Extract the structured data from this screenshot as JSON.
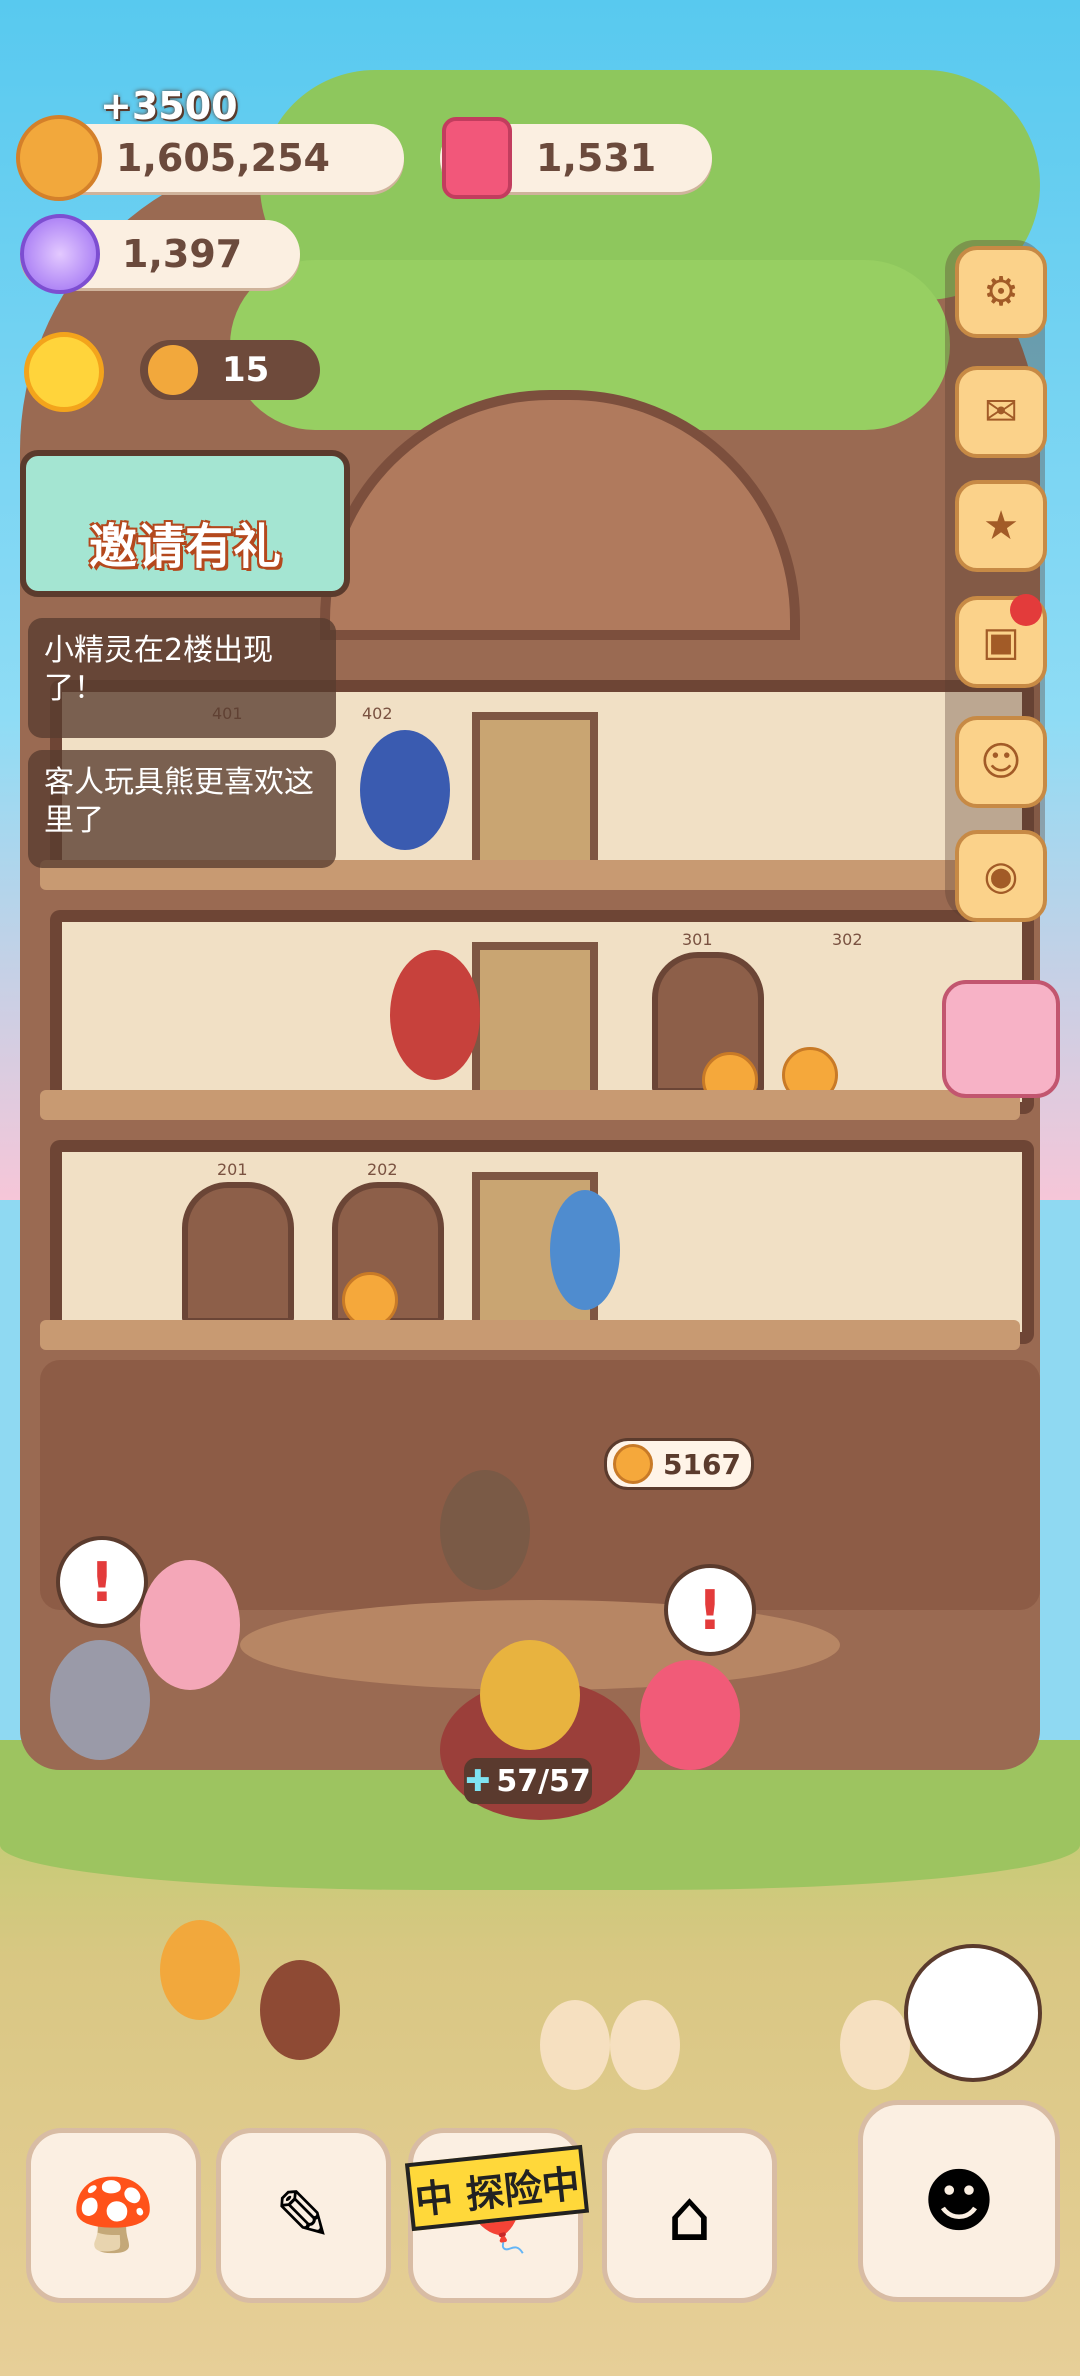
{
  "hud": {
    "gain_text": "+3500",
    "coins": "1,605,254",
    "red_currency": "1,531",
    "gems": "1,397",
    "helper_count": "15"
  },
  "invite": {
    "label": "邀请有礼"
  },
  "messages": [
    {
      "text": "小精灵在2楼出现了！"
    },
    {
      "text": "客人玩具熊更喜欢这里了"
    }
  ],
  "rooms": {
    "r401": "401",
    "r402": "402",
    "r301": "301",
    "r302": "302",
    "r201": "201",
    "r202": "202"
  },
  "lobby": {
    "counter_value": "5167",
    "energy": "57/57"
  },
  "bottom_bar": {
    "explore_badge": "中 探险中"
  },
  "side_buttons": [
    "gear-icon",
    "stamp-icon",
    "star-shop-icon",
    "backpack-icon",
    "ghost-icon",
    "camera-icon"
  ],
  "colors": {
    "wood": "#9a6a52",
    "cream": "#fbefe1",
    "accent": "#f2a83c"
  }
}
